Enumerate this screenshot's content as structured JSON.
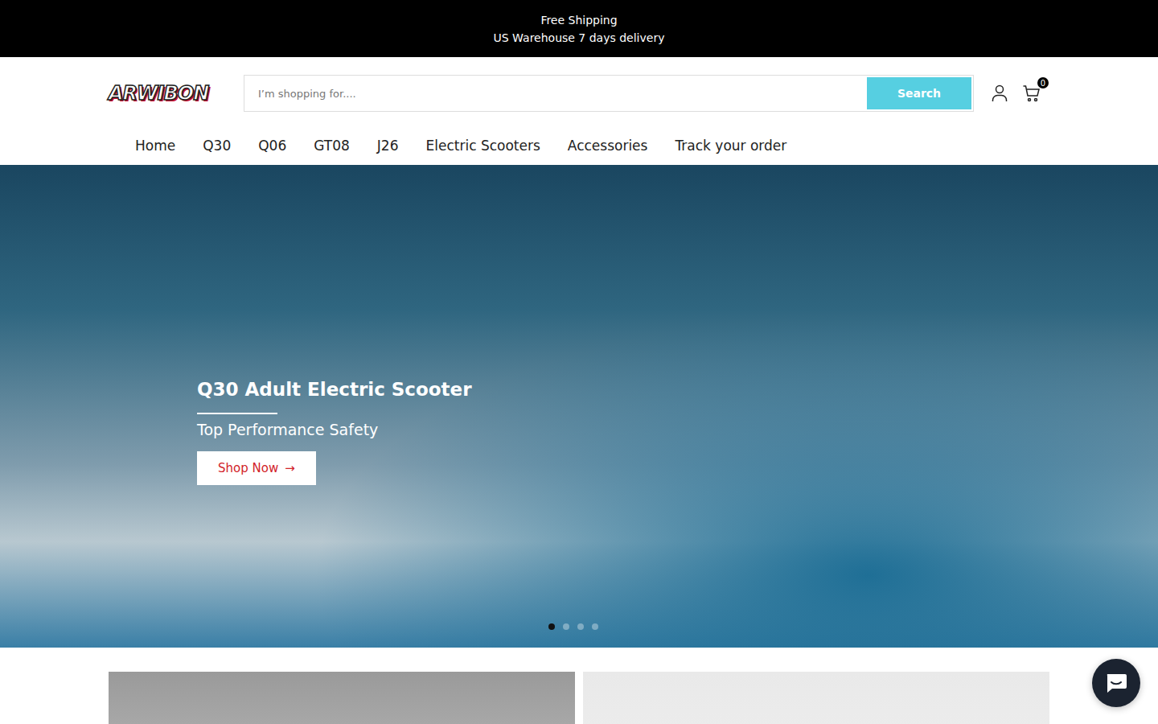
{
  "announcement": [
    "Free Shipping",
    "US Warehouse 7 days delivery"
  ],
  "logo": "ARWIBON",
  "search": {
    "placeholder": "I’m shopping for....",
    "button": "Search"
  },
  "cart": {
    "count": "0"
  },
  "nav": [
    "Home",
    "Q30",
    "Q06",
    "GT08",
    "J26",
    "Electric Scooters",
    "Accessories",
    "Track your order"
  ],
  "hero": {
    "title": "Q30 Adult Electric Scooter",
    "subtitle": "Top Performance Safety",
    "button": "Shop Now",
    "button_icon": "→",
    "dots": [
      {
        "selected": true
      },
      {
        "selected": false
      },
      {
        "selected": false
      },
      {
        "selected": false
      }
    ]
  }
}
